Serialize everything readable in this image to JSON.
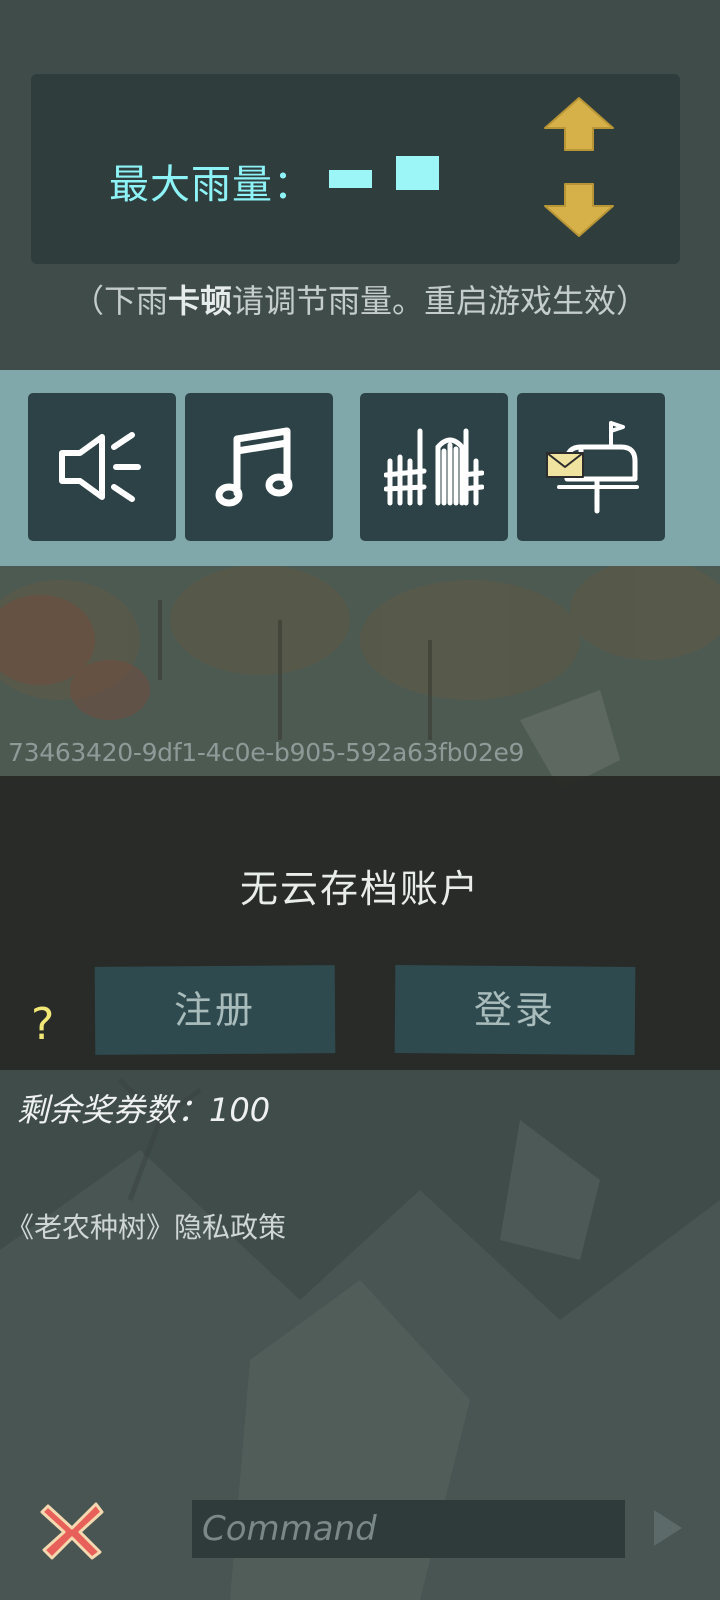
{
  "settings": {
    "rain_label": "最大雨量：",
    "rain_hint_prefix": "（下雨",
    "rain_hint_bold": "卡顿",
    "rain_hint_suffix": "请调节雨量。重启游戏生效）",
    "up_icon": "arrow-up-icon",
    "down_icon": "arrow-down-icon"
  },
  "toolbar": {
    "buttons": [
      {
        "icon": "speaker-icon"
      },
      {
        "icon": "music-note-icon"
      },
      {
        "icon": "fence-gate-icon"
      },
      {
        "icon": "mailbox-icon"
      }
    ]
  },
  "account": {
    "uuid": "73463420-9df1-4c0e-b905-592a63fb02e9",
    "title": "无云存档账户",
    "help": "?",
    "register_label": "注册",
    "login_label": "登录"
  },
  "coupons_text": "剩余奖券数：100",
  "privacy_text": "《老农种树》隐私政策",
  "command": {
    "placeholder": "Command",
    "value": ""
  },
  "colors": {
    "accent_cyan": "#8ef3f6",
    "arrow_gold": "#d6b14a",
    "toolbar_bg": "#80a7a9",
    "button_bg": "#2c4246",
    "close_red": "#e8605a"
  }
}
